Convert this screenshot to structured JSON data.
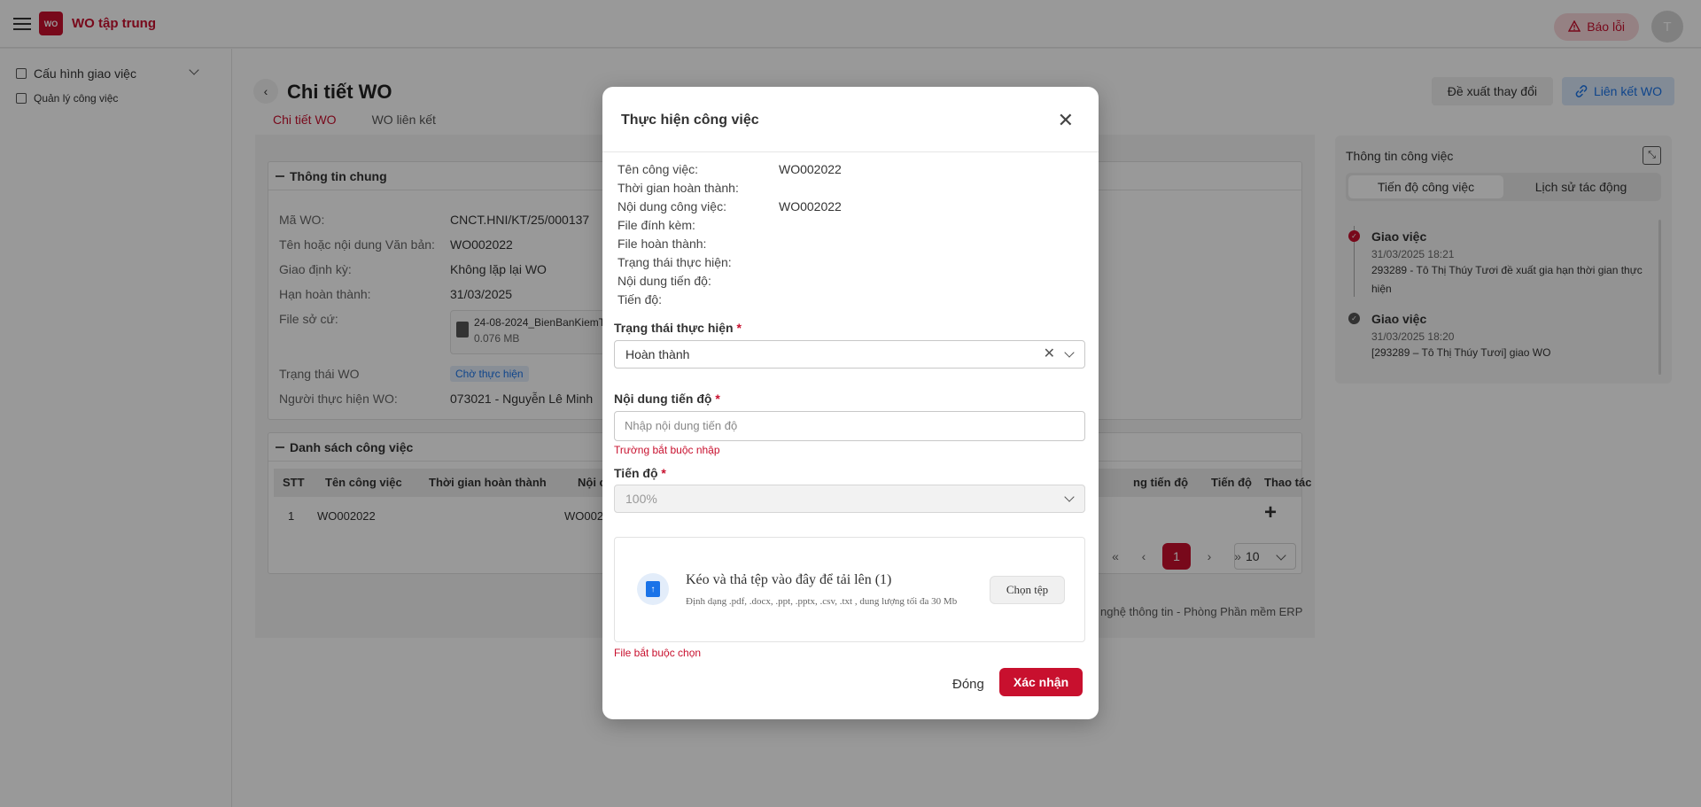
{
  "header": {
    "app_title": "WO tập trung",
    "logo_text": "WO",
    "report_label": "Báo lỗi",
    "avatar_initial": "T"
  },
  "sidebar": {
    "items": [
      {
        "label": "Cấu hình giao việc"
      },
      {
        "label": "Quản lý công việc"
      }
    ]
  },
  "page": {
    "title": "Chi tiết WO",
    "tabs": [
      {
        "label": "Chi tiết WO",
        "active": true
      },
      {
        "label": "WO liên kết",
        "active": false
      }
    ],
    "propose_change_label": "Đề xuất thay đổi",
    "link_wo_label": "Liên kết WO"
  },
  "general_info": {
    "title": "Thông tin chung",
    "rows": [
      {
        "label": "Mã WO:",
        "value": "CNCT.HNI/KT/25/000137"
      },
      {
        "label": "Tên hoặc nội dung Văn bản:",
        "value": "WO002022"
      },
      {
        "label": "Giao định kỳ:",
        "value": "Không lặp lại WO"
      },
      {
        "label": "Hạn hoàn thành:",
        "value": "31/03/2025"
      },
      {
        "label": "File sở cứ:",
        "value": ""
      },
      {
        "label": "Trạng thái WO",
        "value": ""
      },
      {
        "label": "Người thực hiện WO:",
        "value": "073021 - Nguyễn Lê Minh"
      }
    ],
    "file_name": "24-08-2024_BienBanKiemT",
    "file_size": "0.076 MB",
    "status": "Chờ thực hiện"
  },
  "task_list": {
    "title": "Danh sách công việc",
    "columns": [
      "STT",
      "Tên công việc",
      "Thời gian hoàn thành",
      "Nội c",
      "ng tiến độ",
      "Tiến độ",
      "Thao tác"
    ],
    "rows": [
      {
        "stt": "1",
        "name": "WO002022",
        "content": "WO002"
      }
    ],
    "pagination": {
      "first": "«",
      "prev": "‹",
      "current": "1",
      "next": "›",
      "last": "»",
      "page_size": "10"
    }
  },
  "footer": {
    "text": "nghệ thông tin - Phòng Phần mềm ERP"
  },
  "right_panel": {
    "title": "Thông tin công việc",
    "tabs": [
      {
        "label": "Tiến độ công việc",
        "active": true
      },
      {
        "label": "Lịch sử tác động",
        "active": false
      }
    ],
    "timeline": [
      {
        "title": "Giao việc",
        "time": "31/03/2025 18:21",
        "desc": "293289 - Tô Thị Thúy Tươi đề xuất gia hạn thời gian thực hiện",
        "color": "#c8102e"
      },
      {
        "title": "Giao việc",
        "time": "31/03/2025 18:20",
        "desc": "[293289 – Tô Thị Thúy Tươi] giao WO",
        "color": "#555555"
      }
    ]
  },
  "modal": {
    "title": "Thực hiện công việc",
    "close_glyph": "✕",
    "details": [
      {
        "label": "Tên công việc:",
        "value": "WO002022"
      },
      {
        "label": "Thời gian hoàn thành:",
        "value": ""
      },
      {
        "label": "Nội dung công việc:",
        "value": "WO002022"
      },
      {
        "label": "File đính kèm:",
        "value": ""
      },
      {
        "label": "File hoàn thành:",
        "value": ""
      },
      {
        "label": "Trạng thái thực hiện:",
        "value": ""
      },
      {
        "label": "Nội dung tiến độ:",
        "value": ""
      },
      {
        "label": "Tiến độ:",
        "value": ""
      }
    ],
    "status_field": {
      "label": "Trạng thái thực hiện",
      "value": "Hoàn thành"
    },
    "progress_content_field": {
      "label": "Nội dung tiến độ",
      "placeholder": "Nhập nội dung tiến độ",
      "error": "Trường bắt buộc nhập"
    },
    "progress_field": {
      "label": "Tiến độ",
      "value": "100%"
    },
    "upload": {
      "title": "Kéo và thả tệp vào đây để tải lên (1)",
      "hint": "Định dạng .pdf, .docx, .ppt, .pptx, .csv, .txt , dung lượng tối đa 30 Mb",
      "choose_label": "Chọn tệp",
      "error": "File bắt buộc chọn"
    },
    "close_label": "Đóng",
    "confirm_label": "Xác nhận"
  },
  "colors": {
    "brand": "#c8102e",
    "link": "#1a73e8"
  }
}
